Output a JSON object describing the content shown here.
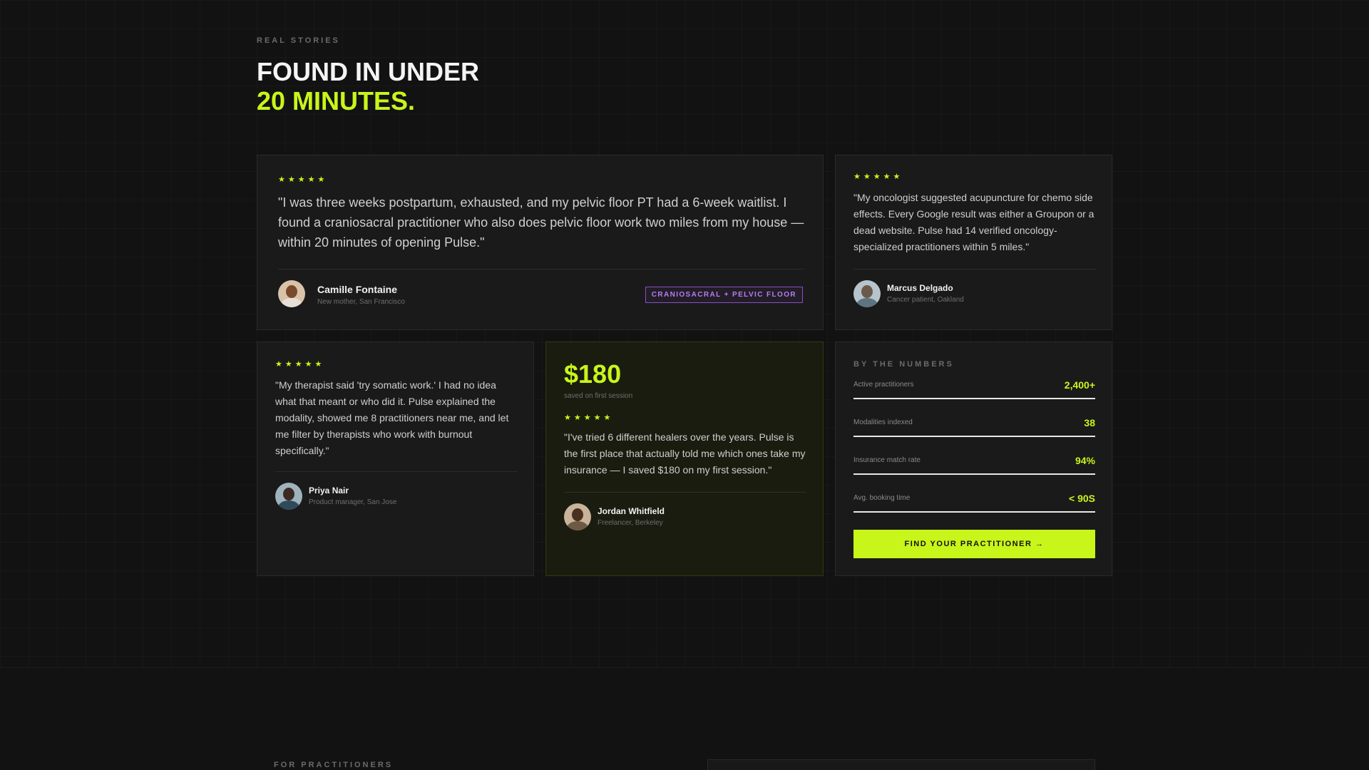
{
  "header": {
    "eyebrow": "REAL STORIES",
    "headline_line1": "FOUND IN UNDER",
    "headline_line2": "20 MINUTES."
  },
  "colors": {
    "accent": "#c8f51a",
    "background": "#121212",
    "card": "#1a1a1a",
    "tag": "#8a4cc9"
  },
  "testimonials": [
    {
      "stars": "★★★★★",
      "quote": "\"I was three weeks postpartum, exhausted, and my pelvic floor PT had a 6-week waitlist. I found a craniosacral practitioner who also does pelvic floor work two miles from my house — within 20 minutes of opening Pulse.\"",
      "name": "Camille Fontaine",
      "role": "New mother, San Francisco",
      "tag": "CRANIOSACRAL + PELVIC FLOOR"
    },
    {
      "stars": "★★★★★",
      "quote": "\"My oncologist suggested acupuncture for chemo side effects. Every Google result was either a Groupon or a dead website. Pulse had 14 verified oncology-specialized practitioners within 5 miles.\"",
      "name": "Marcus Delgado",
      "role": "Cancer patient, Oakland"
    },
    {
      "stars": "★★★★★",
      "quote": "\"My therapist said 'try somatic work.' I had no idea what that meant or who did it. Pulse explained the modality, showed me 8 practitioners near me, and let me filter by therapists who work with burnout specifically.\"",
      "name": "Priya Nair",
      "role": "Product manager, San Jose"
    },
    {
      "amount": "$180",
      "amount_note": "saved on first session",
      "stars": "★★★★★",
      "quote": "\"I've tried 6 different healers over the years. Pulse is the first place that actually told me which ones take my insurance — I saved $180 on my first session.\"",
      "name": "Jordan Whitfield",
      "role": "Freelancer, Berkeley"
    }
  ],
  "numbers": {
    "title": "BY THE NUMBERS",
    "rows": [
      {
        "label": "Active practitioners",
        "value": "2,400+"
      },
      {
        "label": "Modalities indexed",
        "value": "38"
      },
      {
        "label": "Insurance match rate",
        "value": "94%"
      },
      {
        "label": "Avg. booking time",
        "value": "< 90S"
      }
    ],
    "cta_label": "FIND YOUR PRACTITIONER →"
  },
  "lower_section": {
    "eyebrow": "FOR PRACTITIONERS"
  }
}
